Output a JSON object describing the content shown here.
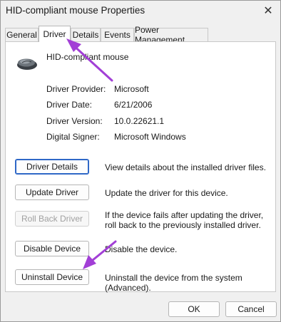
{
  "window": {
    "title": "HID-compliant mouse Properties",
    "close_glyph": "✕"
  },
  "tabs": [
    {
      "label": "General",
      "active": false
    },
    {
      "label": "Driver",
      "active": true
    },
    {
      "label": "Details",
      "active": false
    },
    {
      "label": "Events",
      "active": false
    },
    {
      "label": "Power Management",
      "active": false
    }
  ],
  "device": {
    "name": "HID-compliant mouse",
    "icon": "mouse-icon"
  },
  "driver_info": [
    {
      "label": "Driver Provider:",
      "value": "Microsoft"
    },
    {
      "label": "Driver Date:",
      "value": "6/21/2006"
    },
    {
      "label": "Driver Version:",
      "value": "10.0.22621.1"
    },
    {
      "label": "Digital Signer:",
      "value": "Microsoft Windows"
    }
  ],
  "actions": [
    {
      "label": "Driver Details",
      "description": "View details about the installed driver files.",
      "enabled": true
    },
    {
      "label": "Update Driver",
      "description": "Update the driver for this device.",
      "enabled": true
    },
    {
      "label": "Roll Back Driver",
      "description": "If the device fails after updating the driver, roll back to the previously installed driver.",
      "enabled": false
    },
    {
      "label": "Disable Device",
      "description": "Disable the device.",
      "enabled": true
    },
    {
      "label": "Uninstall Device",
      "description": "Uninstall the device from the system (Advanced).",
      "enabled": true
    }
  ],
  "footer": {
    "ok_label": "OK",
    "cancel_label": "Cancel"
  },
  "colors": {
    "annotation_arrow": "#a23fd6",
    "focus_border": "#2f68c7"
  }
}
